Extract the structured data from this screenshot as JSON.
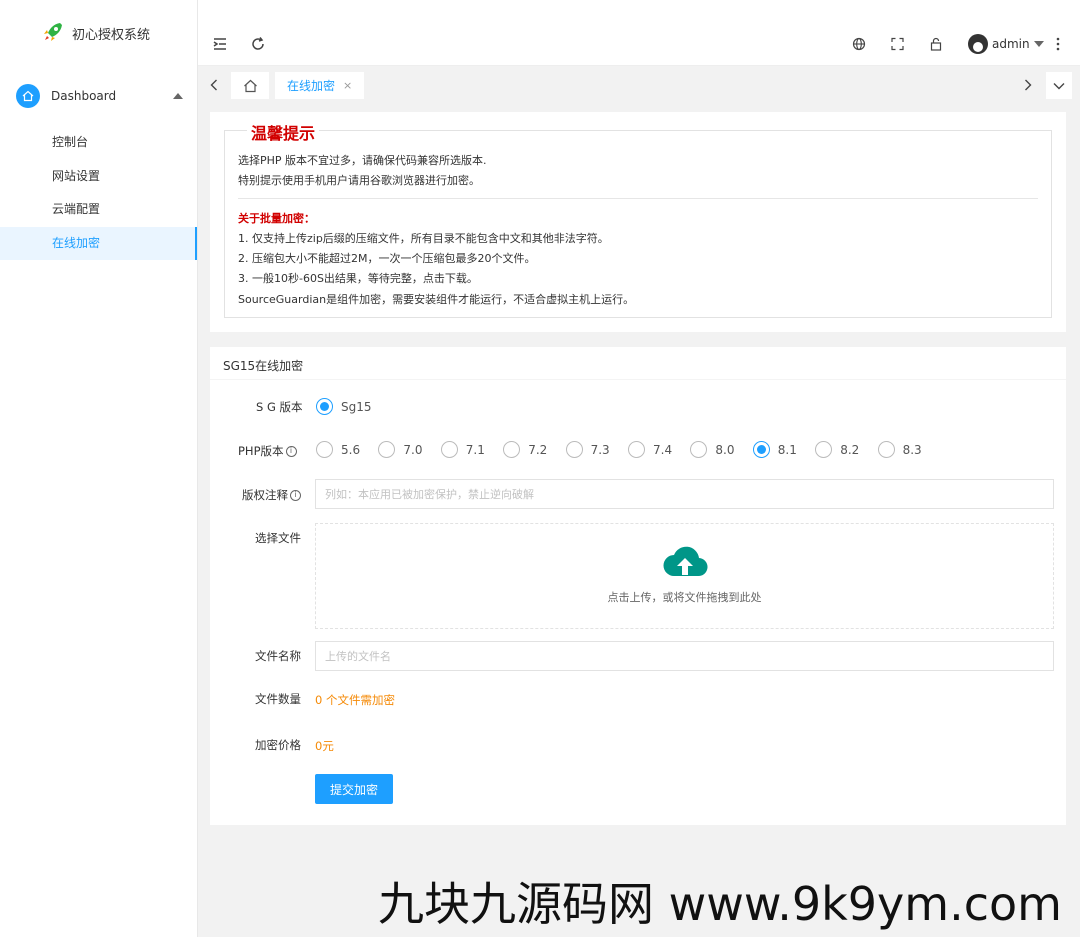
{
  "app": {
    "title": "初心授权系统"
  },
  "sidebar": {
    "group_label": "Dashboard",
    "items": [
      {
        "label": "控制台"
      },
      {
        "label": "网站设置"
      },
      {
        "label": "云端配置"
      },
      {
        "label": "在线加密"
      }
    ]
  },
  "header": {
    "username": "admin"
  },
  "tabs": {
    "active_label": "在线加密",
    "close_glyph": "×"
  },
  "notice": {
    "title": "温馨提示",
    "lines": [
      "选择PHP 版本不宜过多，请确保代码兼容所选版本.",
      "特别提示使用手机用户请用谷歌浏览器进行加密。"
    ],
    "batch_title": "关于批量加密：",
    "batch_lines": [
      "1. 仅支持上传zip后缀的压缩文件，所有目录不能包含中文和其他非法字符。",
      "2. 压缩包大小不能超过2M，一次一个压缩包最多20个文件。",
      "3. 一般10秒-60S出结果，等待完整，点击下载。",
      "SourceGuardian是组件加密，需要安装组件才能运行，不适合虚拟主机上运行。"
    ]
  },
  "form": {
    "title": "SG15在线加密",
    "sg_label": "S G 版本",
    "sg_option": "Sg15",
    "php_label": "PHP版本",
    "php_options": [
      "5.6",
      "7.0",
      "7.1",
      "7.2",
      "7.3",
      "7.4",
      "8.0",
      "8.1",
      "8.2",
      "8.3"
    ],
    "php_selected": "8.1",
    "copyright_label": "版权注释",
    "copyright_placeholder": "列如：本应用已被加密保护，禁止逆向破解",
    "file_label": "选择文件",
    "upload_text": "点击上传，或将文件拖拽到此处",
    "filename_label": "文件名称",
    "filename_placeholder": "上传的文件名",
    "count_label": "文件数量",
    "count_value": "0 个文件需加密",
    "price_label": "加密价格",
    "price_value": "0元",
    "submit_label": "提交加密"
  },
  "colors": {
    "accent": "#1e9fff",
    "upload_icon": "#009688",
    "notice_red": "#d10000",
    "orange": "#f58a07"
  },
  "icons": [
    "rocket-icon",
    "home-icon",
    "menu-fold-icon",
    "refresh-icon",
    "globe-icon",
    "fullscreen-icon",
    "lock-icon",
    "more-icon",
    "chevron-left-icon",
    "chevron-right-icon",
    "chevron-down-icon",
    "cloud-upload-icon",
    "info-icon"
  ],
  "watermark": "九块九源码网 www.9k9ym.com"
}
